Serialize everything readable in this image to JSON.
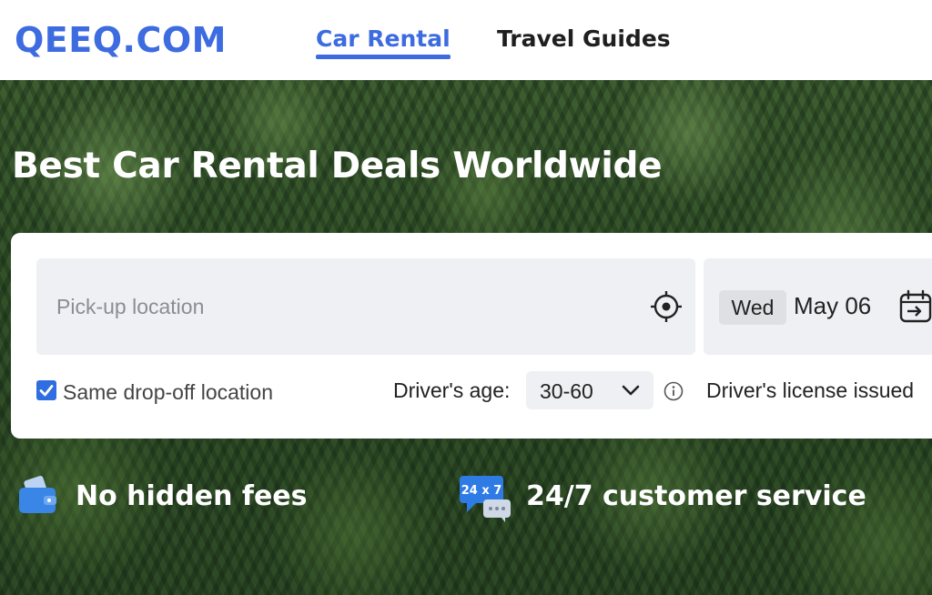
{
  "header": {
    "logo_text": "QEEQ.COM",
    "nav": [
      {
        "label": "Car Rental",
        "active": true
      },
      {
        "label": "Travel Guides",
        "active": false
      }
    ]
  },
  "hero": {
    "title": "Best Car Rental Deals Worldwide"
  },
  "search": {
    "pickup_placeholder": "Pick-up location",
    "pickup_value": "",
    "pickup_icon": "locate-crosshair-icon",
    "date": {
      "day": "Wed",
      "date": "May 06",
      "icon": "calendar-icon"
    },
    "same_dropoff": {
      "label": "Same drop-off location",
      "checked": true
    },
    "driver_age": {
      "label": "Driver's age:",
      "value": "30-60",
      "icon": "chevron-down-icon"
    },
    "info_icon": "info-icon",
    "license_label": "Driver's license issued"
  },
  "features": [
    {
      "icon": "wallet-icon",
      "label": "No hidden fees"
    },
    {
      "icon": "chat-24x7-icon",
      "icon_text": "24 x 7",
      "label": "24/7 customer service"
    }
  ],
  "colors": {
    "brand": "#3d6be0",
    "accent": "#2ec4b6",
    "field_bg": "#eff0f4",
    "checkbox": "#2f6ee0"
  }
}
